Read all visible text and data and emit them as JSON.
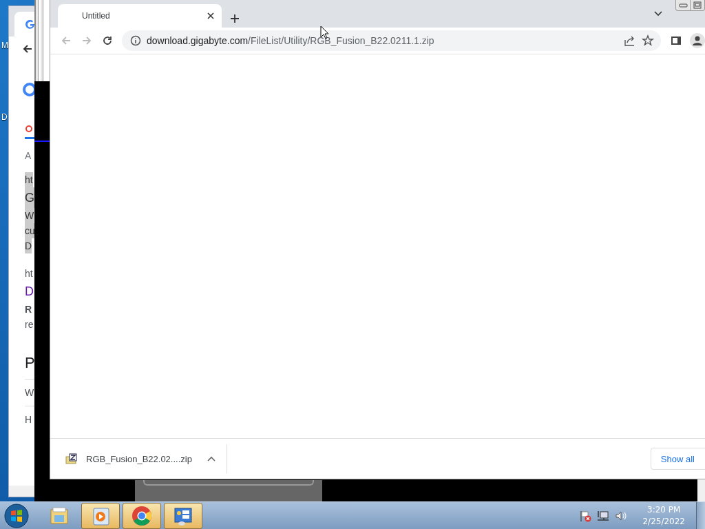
{
  "desktop": {
    "icon_labels": [
      "M",
      "D"
    ]
  },
  "background_window": {
    "groups": [
      [
        {
          "text": "A",
          "kind": "meta"
        }
      ],
      [
        {
          "text": "ht",
          "kind": "marked"
        },
        {
          "text": "G",
          "kind": "marked-title"
        },
        {
          "text": "W",
          "kind": "marked"
        },
        {
          "text": "cu",
          "kind": "marked"
        },
        {
          "text": "D",
          "kind": "marked"
        }
      ],
      [
        {
          "text": "ht",
          "kind": "plain"
        },
        {
          "text": "D",
          "kind": "link"
        },
        {
          "text": "R",
          "kind": "bold"
        },
        {
          "text": "re",
          "kind": "plain"
        }
      ],
      [
        {
          "text": "P",
          "kind": "heading"
        }
      ],
      [
        {
          "text": "W",
          "kind": "plain"
        }
      ],
      [
        {
          "text": "H",
          "kind": "plain"
        }
      ]
    ]
  },
  "browser": {
    "tabs": [
      {
        "title": "Untitled",
        "selected": true
      }
    ],
    "nav": [
      {
        "kind": "back",
        "disabled": true
      },
      {
        "kind": "forward",
        "disabled": true
      },
      {
        "kind": "reload",
        "disabled": false
      }
    ],
    "address": {
      "host": "download.gigabyte.com",
      "path": "/FileList/Utility/RGB_Fusion_B22.0211.1.zip"
    },
    "downloads": [
      {
        "file": "RGB_Fusion_B22.02....zip"
      }
    ],
    "show_all": "Show all"
  },
  "taskbar": {
    "apps": [
      {
        "kind": "explorer",
        "open": false
      },
      {
        "kind": "media",
        "open": true
      },
      {
        "kind": "chrome",
        "open": true
      },
      {
        "kind": "control",
        "open": true
      }
    ],
    "clock": {
      "time": "3:20 PM",
      "date": "2/25/2022"
    }
  }
}
